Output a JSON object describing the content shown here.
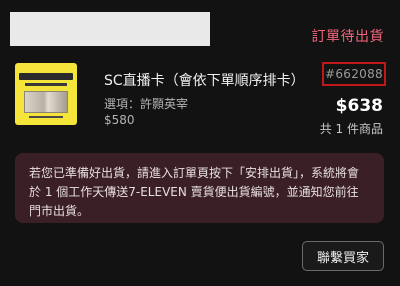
{
  "order": {
    "status": "訂單待出貨",
    "number": "#662088",
    "total": "$638",
    "item_count": "共 1 件商品"
  },
  "product": {
    "image_icon": "product-thumbnail",
    "name": "SC直播卡（會依下單順序排卡）",
    "option": "選項：許顥英宰",
    "price": "$580"
  },
  "notice": {
    "text": "若您已準備好出貨，請進入訂單頁按下「安排出貨」，系統將會於 1 個工作天傳送7-ELEVEN 賣貨便出貨編號，並通知您前往門市出貨。"
  },
  "actions": {
    "contact_buyer_label": "聯繫買家"
  },
  "colors": {
    "status": "#f2657b",
    "highlight_border": "#c01818",
    "notice_background": "#3b1f26"
  }
}
